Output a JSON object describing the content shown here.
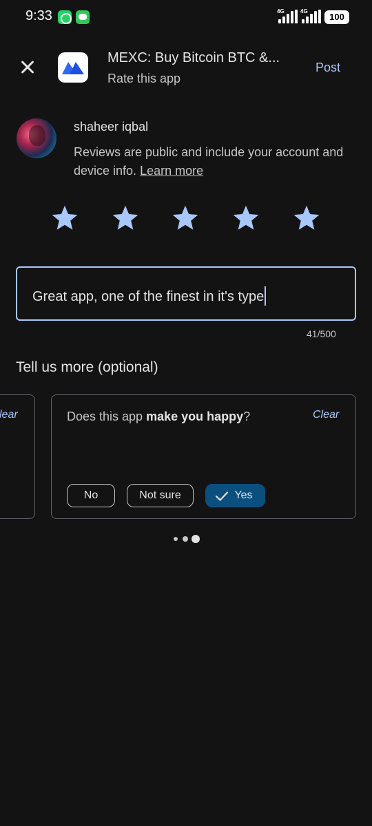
{
  "status_bar": {
    "time": "9:33",
    "network_1": "4G",
    "network_2": "4G",
    "battery": "100"
  },
  "header": {
    "app_title": "MEXC: Buy Bitcoin BTC &...",
    "subtitle": "Rate this app",
    "post_label": "Post"
  },
  "user": {
    "name": "shaheer iqbal",
    "disclaimer": "Reviews are public and include your account and device info. ",
    "learn_more": "Learn more"
  },
  "rating": {
    "stars": 5,
    "max": 5,
    "color": "#a8c7fa"
  },
  "review": {
    "text": "Great app, one of the finest in it's type",
    "char_count": "41/500"
  },
  "tell_more": {
    "heading": "Tell us more (optional)",
    "prev_card_clear": "lear",
    "card": {
      "question_prefix": "Does this app ",
      "question_bold": "make you happy",
      "question_suffix": "?",
      "clear_label": "Clear",
      "options": [
        "No",
        "Not sure",
        "Yes"
      ],
      "selected": "Yes"
    }
  },
  "pagination": {
    "count": 3,
    "active": 3
  },
  "colors": {
    "background": "#131313",
    "accent": "#a8c7fa",
    "selected_chip": "#0b4f7e"
  }
}
